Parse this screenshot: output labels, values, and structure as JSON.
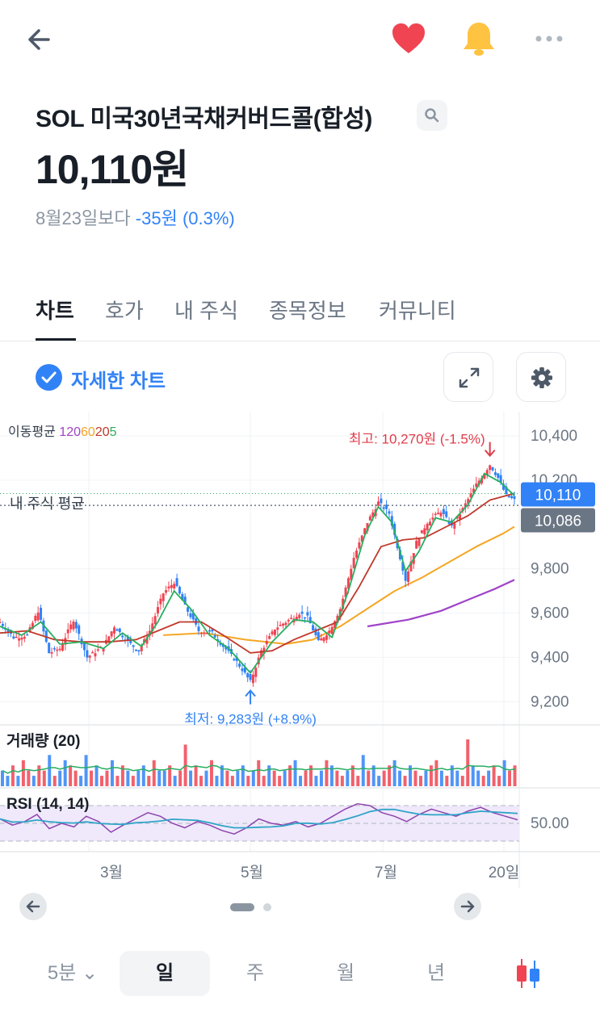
{
  "header": {
    "back_icon": "arrow-left-icon",
    "favorite_icon": "heart-icon",
    "alert_icon": "bell-icon",
    "more_icon": "more-horizontal-icon",
    "favorite_color": "#f04452",
    "alert_color": "#ffc342"
  },
  "stock": {
    "name": "SOL 미국30년국채커버드콜(합성)",
    "price": "10,110원",
    "change_reference": "8월23일보다",
    "change_value": "-35원 (0.3%)",
    "change_color": "#3182f6"
  },
  "tabs": [
    {
      "label": "차트",
      "active": true
    },
    {
      "label": "호가",
      "active": false
    },
    {
      "label": "내 주식",
      "active": false
    },
    {
      "label": "종목정보",
      "active": false
    },
    {
      "label": "커뮤니티",
      "active": false
    }
  ],
  "chart_toolbar": {
    "detail_label": "자세한 차트",
    "detail_checked": true,
    "expand_icon": "expand-icon",
    "settings_icon": "gear-icon"
  },
  "chart_data": {
    "type": "candlestick",
    "moving_average_title": "이동평균",
    "moving_averages": [
      {
        "label": "120",
        "color": "#a043c8"
      },
      {
        "label": "60",
        "color": "#f5a623"
      },
      {
        "label": "20",
        "color": "#c0392b"
      },
      {
        "label": "5",
        "color": "#27ae60"
      }
    ],
    "y_ticks": [
      "10,400",
      "10,200",
      "9,800",
      "9,600",
      "9,400",
      "9,200"
    ],
    "y_tick_values": [
      10400,
      10200,
      9800,
      9600,
      9400,
      9200
    ],
    "ylim": [
      9150,
      10480
    ],
    "x_ticks": [
      "3월",
      "5월",
      "7월",
      "20일"
    ],
    "current_price_label": "10,110",
    "current_price": 10110,
    "avg_price_label": "10,086",
    "avg_price": 10086,
    "avg_line_label": "내 주식 평균",
    "high_label": "최고: 10,270원 (-1.5%)",
    "high_value": 10270,
    "low_label": "최저: 9,283원 (+8.9%)",
    "low_value": 9283,
    "up_color": "#f04452",
    "down_color": "#3182f6",
    "volume_title": "거래량 (20)",
    "rsi_title": "RSI (14, 14)",
    "rsi_tick": "50.00",
    "price_path": [
      [
        0,
        9560
      ],
      [
        5,
        9490
      ],
      [
        10,
        9500
      ],
      [
        14,
        9610
      ],
      [
        18,
        9420
      ],
      [
        22,
        9440
      ],
      [
        27,
        9570
      ],
      [
        32,
        9400
      ],
      [
        38,
        9450
      ],
      [
        42,
        9540
      ],
      [
        47,
        9470
      ],
      [
        51,
        9430
      ],
      [
        55,
        9520
      ],
      [
        60,
        9690
      ],
      [
        64,
        9740
      ],
      [
        68,
        9630
      ],
      [
        73,
        9520
      ],
      [
        78,
        9510
      ],
      [
        82,
        9450
      ],
      [
        87,
        9380
      ],
      [
        92,
        9290
      ],
      [
        96,
        9430
      ],
      [
        101,
        9530
      ],
      [
        105,
        9560
      ],
      [
        110,
        9600
      ],
      [
        113,
        9580
      ],
      [
        117,
        9470
      ],
      [
        121,
        9520
      ],
      [
        125,
        9620
      ],
      [
        130,
        9850
      ],
      [
        135,
        10010
      ],
      [
        139,
        10100
      ],
      [
        143,
        10050
      ],
      [
        146,
        9900
      ],
      [
        149,
        9750
      ],
      [
        153,
        9920
      ],
      [
        157,
        10010
      ],
      [
        162,
        10060
      ],
      [
        166,
        9990
      ],
      [
        170,
        10070
      ],
      [
        175,
        10180
      ],
      [
        180,
        10270
      ],
      [
        183,
        10210
      ],
      [
        186,
        10130
      ],
      [
        189,
        10110
      ]
    ],
    "ma5": [
      [
        0,
        9540
      ],
      [
        8,
        9500
      ],
      [
        15,
        9560
      ],
      [
        22,
        9460
      ],
      [
        30,
        9470
      ],
      [
        38,
        9440
      ],
      [
        45,
        9510
      ],
      [
        52,
        9450
      ],
      [
        58,
        9560
      ],
      [
        64,
        9700
      ],
      [
        70,
        9620
      ],
      [
        77,
        9500
      ],
      [
        84,
        9440
      ],
      [
        92,
        9330
      ],
      [
        100,
        9470
      ],
      [
        108,
        9570
      ],
      [
        115,
        9560
      ],
      [
        122,
        9490
      ],
      [
        128,
        9700
      ],
      [
        134,
        9950
      ],
      [
        139,
        10080
      ],
      [
        144,
        10010
      ],
      [
        149,
        9790
      ],
      [
        154,
        9880
      ],
      [
        160,
        10030
      ],
      [
        166,
        10010
      ],
      [
        172,
        10090
      ],
      [
        178,
        10230
      ],
      [
        184,
        10190
      ],
      [
        189,
        10130
      ]
    ],
    "ma20": [
      [
        0,
        9510
      ],
      [
        10,
        9520
      ],
      [
        20,
        9480
      ],
      [
        30,
        9470
      ],
      [
        40,
        9470
      ],
      [
        50,
        9480
      ],
      [
        58,
        9520
      ],
      [
        66,
        9560
      ],
      [
        74,
        9560
      ],
      [
        82,
        9500
      ],
      [
        92,
        9420
      ],
      [
        100,
        9430
      ],
      [
        108,
        9480
      ],
      [
        116,
        9520
      ],
      [
        124,
        9560
      ],
      [
        132,
        9720
      ],
      [
        140,
        9900
      ],
      [
        148,
        9930
      ],
      [
        156,
        9940
      ],
      [
        164,
        9990
      ],
      [
        172,
        10040
      ],
      [
        180,
        10110
      ],
      [
        189,
        10140
      ]
    ],
    "ma60": [
      [
        60,
        9500
      ],
      [
        75,
        9510
      ],
      [
        90,
        9480
      ],
      [
        105,
        9460
      ],
      [
        115,
        9480
      ],
      [
        125,
        9540
      ],
      [
        135,
        9620
      ],
      [
        145,
        9700
      ],
      [
        155,
        9760
      ],
      [
        165,
        9830
      ],
      [
        175,
        9900
      ],
      [
        185,
        9960
      ],
      [
        189,
        9990
      ]
    ],
    "ma120": [
      [
        135,
        9540
      ],
      [
        150,
        9570
      ],
      [
        162,
        9610
      ],
      [
        172,
        9660
      ],
      [
        182,
        9710
      ],
      [
        189,
        9750
      ]
    ],
    "volume": [
      3,
      2,
      4,
      2,
      5,
      3,
      2,
      4,
      3,
      6,
      2,
      3,
      5,
      4,
      3,
      2,
      6,
      3,
      4,
      2,
      3,
      5,
      2,
      4,
      3,
      2,
      3,
      4,
      2,
      5,
      3,
      3,
      4,
      2,
      3,
      8,
      3,
      4,
      2,
      3,
      5,
      2,
      4,
      3,
      2,
      3,
      4,
      2,
      3,
      5,
      2,
      4,
      3,
      2,
      3,
      4,
      5,
      2,
      3,
      4,
      2,
      3,
      5,
      4,
      3,
      2,
      3,
      4,
      2,
      6,
      3,
      4,
      2,
      3,
      4,
      5,
      3,
      2,
      4,
      3,
      2,
      3,
      4,
      5,
      3,
      2,
      4,
      3,
      2,
      9,
      4,
      3,
      2,
      3,
      4,
      2,
      5,
      3,
      4
    ],
    "rsi": [
      55,
      48,
      52,
      60,
      44,
      50,
      46,
      58,
      52,
      40,
      48,
      55,
      62,
      58,
      50,
      45,
      52,
      48,
      42,
      38,
      45,
      55,
      50,
      48,
      52,
      46,
      50,
      58,
      66,
      72,
      70,
      62,
      58,
      52,
      60,
      66,
      62,
      58,
      64,
      68,
      62,
      58,
      54
    ]
  },
  "pager": {
    "prev_icon": "arrow-left-circle-icon",
    "next_icon": "arrow-right-circle-icon"
  },
  "periods": [
    {
      "label": "5분 ⌄",
      "active": false
    },
    {
      "label": "일",
      "active": true
    },
    {
      "label": "주",
      "active": false
    },
    {
      "label": "월",
      "active": false
    },
    {
      "label": "년",
      "active": false
    }
  ],
  "chart_style_icon": "candlestick-icon"
}
